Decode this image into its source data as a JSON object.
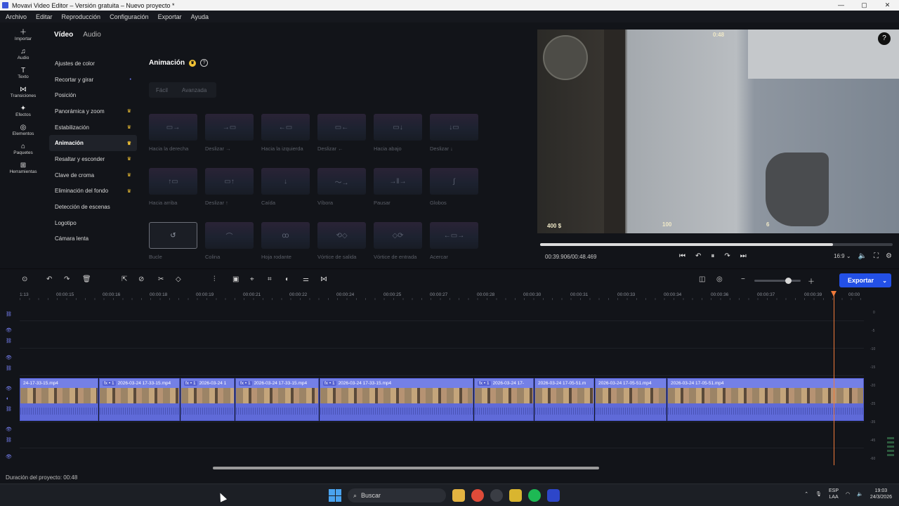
{
  "window": {
    "title": "Movavi Video Editor – Versión gratuita – Nuevo proyecto *"
  },
  "menu": [
    "Archivo",
    "Editar",
    "Reproducción",
    "Configuración",
    "Exportar",
    "Ayuda"
  ],
  "tools": [
    {
      "icon": "plus-icon",
      "label": "Importar"
    },
    {
      "icon": "music-icon",
      "label": "Audio"
    },
    {
      "icon": "text-icon",
      "label": "Texto"
    },
    {
      "icon": "transitions-icon",
      "label": "Transiciones"
    },
    {
      "icon": "effects-icon",
      "label": "Efectos"
    },
    {
      "icon": "elements-icon",
      "label": "Elementos"
    },
    {
      "icon": "packages-icon",
      "label": "Paquetes"
    },
    {
      "icon": "tools-icon",
      "label": "Herramientas"
    }
  ],
  "tabs": [
    "Vídeo",
    "Audio"
  ],
  "nav": [
    {
      "label": "Ajustes de color",
      "mark": ""
    },
    {
      "label": "Recortar y girar",
      "mark": "•"
    },
    {
      "label": "Posición",
      "mark": ""
    },
    {
      "label": "Panorámica y zoom",
      "mark": "♛"
    },
    {
      "label": "Estabilización",
      "mark": "♛"
    },
    {
      "label": "Animación",
      "mark": "♛"
    },
    {
      "label": "Resaltar y esconder",
      "mark": "♛"
    },
    {
      "label": "Clave de croma",
      "mark": "♛"
    },
    {
      "label": "Eliminación del fondo",
      "mark": "♛"
    },
    {
      "label": "Detección de escenas",
      "mark": ""
    },
    {
      "label": "Logotipo",
      "mark": ""
    },
    {
      "label": "Cámara lenta",
      "mark": ""
    }
  ],
  "animation": {
    "title": "Animación",
    "modes": [
      "Fácil",
      "Avanzada"
    ],
    "effects": [
      "Hacia la derecha",
      "Deslizar →",
      "Hacia la izquierda",
      "Deslizar ←",
      "Hacia abajo",
      "Deslizar ↓",
      "Hacia arriba",
      "Deslizar ↑",
      "Caída",
      "Víbora",
      "Pausar",
      "Globos",
      "Bucle",
      "Colina",
      "Hoja rodante",
      "Vórtice de salida",
      "Vórtice de entrada",
      "Acercar"
    ]
  },
  "preview": {
    "hud_health": "100",
    "hud_ammo": "6",
    "hud_money": "400 $",
    "hud_timer": "0:48",
    "time_current": "00:39.906",
    "time_total": "00:48.469",
    "progress_fraction": 0.83,
    "aspect": "16:9"
  },
  "toolbar": {
    "export_label": "Exportar"
  },
  "ruler": [
    "1:13",
    "00:00:15",
    "00:00:16",
    "00:00:18",
    "00:00:19",
    "00:00:21",
    "00:00:22",
    "00:00:24",
    "00:00:25",
    "00:00:27",
    "00:00:28",
    "00:00:30",
    "00:00:31",
    "00:00:33",
    "00:00:34",
    "00:00:36",
    "00:00:37",
    "00:00:39",
    "00:00"
  ],
  "clips": [
    {
      "name": "24-17-33-15.mp4",
      "fx": ""
    },
    {
      "name": "2026-03-24 17-33-15.mp4",
      "fx": "fx • 1"
    },
    {
      "name": "2026-03-24 1",
      "fx": "fx • 1"
    },
    {
      "name": "2026-03-24 17-33-15.mp4",
      "fx": "fx • 1"
    },
    {
      "name": "2026-03-24 17-33-15.mp4",
      "fx": "fx • 1"
    },
    {
      "name": "2026-03-24 17-",
      "fx": "fx • 1"
    },
    {
      "name": "2026-03-24 17-05-51.m",
      "fx": ""
    },
    {
      "name": "2026-03-24 17-05-51.mp4",
      "fx": ""
    },
    {
      "name": "2026-03-24 17-05-51.mp4",
      "fx": ""
    }
  ],
  "meter_labels": [
    "0",
    "-5",
    "-10",
    "-15",
    "-20",
    "-25",
    "-30",
    "-35",
    "-40",
    "-45",
    "-50",
    "-60"
  ],
  "status": {
    "duration": "Duración del proyecto: 00:48"
  },
  "taskbar": {
    "search": "Buscar",
    "lang1": "ESP",
    "lang2": "LAA",
    "time": "19:03",
    "date": "24/3/2026"
  }
}
